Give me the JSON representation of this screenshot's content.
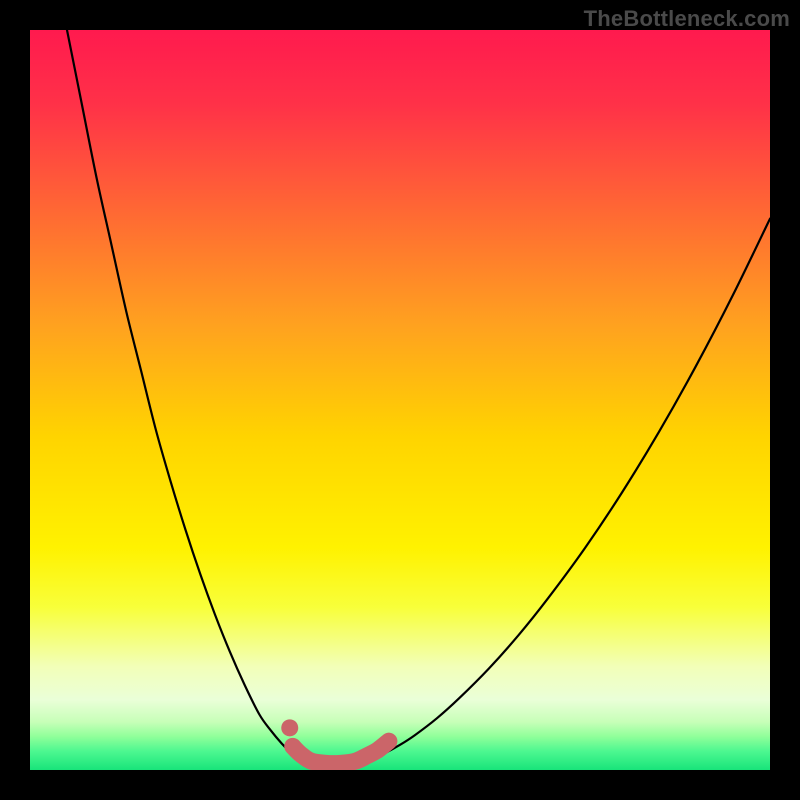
{
  "watermark": "TheBottleneck.com",
  "chart_data": {
    "type": "line",
    "title": "",
    "xlabel": "",
    "ylabel": "",
    "xlim": [
      0,
      100
    ],
    "ylim": [
      0,
      100
    ],
    "series": [
      {
        "name": "left-curve",
        "x": [
          5,
          7,
          9,
          11,
          13,
          15,
          17,
          19,
          21,
          23,
          25,
          27,
          29,
          31,
          32.5,
          34,
          35,
          36,
          37
        ],
        "y": [
          100,
          90,
          80,
          71,
          62,
          54,
          46,
          39,
          32.5,
          26.5,
          21,
          16,
          11.5,
          7.5,
          5.4,
          3.6,
          2.6,
          1.8,
          1.2
        ]
      },
      {
        "name": "right-curve",
        "x": [
          46,
          48,
          50,
          52,
          55,
          58,
          62,
          66,
          70,
          75,
          80,
          85,
          90,
          95,
          100
        ],
        "y": [
          1.4,
          2.3,
          3.4,
          4.7,
          7.0,
          9.7,
          13.7,
          18.2,
          23.2,
          30.0,
          37.5,
          45.7,
          54.6,
          64.2,
          74.5
        ]
      },
      {
        "name": "highlight-band",
        "x": [
          35.5,
          36.5,
          38,
          40,
          42,
          44,
          45.5,
          47,
          48.5
        ],
        "y": [
          3.2,
          2.2,
          1.2,
          0.9,
          0.9,
          1.2,
          1.9,
          2.7,
          3.9
        ]
      }
    ],
    "highlight_dot": {
      "x": 35.1,
      "y": 5.7
    },
    "background_gradient": {
      "stops": [
        {
          "offset": 0.0,
          "color": "#ff1a4e"
        },
        {
          "offset": 0.1,
          "color": "#ff3148"
        },
        {
          "offset": 0.25,
          "color": "#ff6a33"
        },
        {
          "offset": 0.4,
          "color": "#ffa21f"
        },
        {
          "offset": 0.55,
          "color": "#ffd400"
        },
        {
          "offset": 0.7,
          "color": "#fff200"
        },
        {
          "offset": 0.78,
          "color": "#f8ff3a"
        },
        {
          "offset": 0.86,
          "color": "#f2ffb8"
        },
        {
          "offset": 0.905,
          "color": "#eaffd8"
        },
        {
          "offset": 0.935,
          "color": "#c7ffb8"
        },
        {
          "offset": 0.955,
          "color": "#8fff9a"
        },
        {
          "offset": 0.975,
          "color": "#4cf790"
        },
        {
          "offset": 1.0,
          "color": "#18e47a"
        }
      ]
    },
    "colors": {
      "curve": "#000000",
      "highlight": "#cb6569",
      "frame": "#000000"
    }
  }
}
